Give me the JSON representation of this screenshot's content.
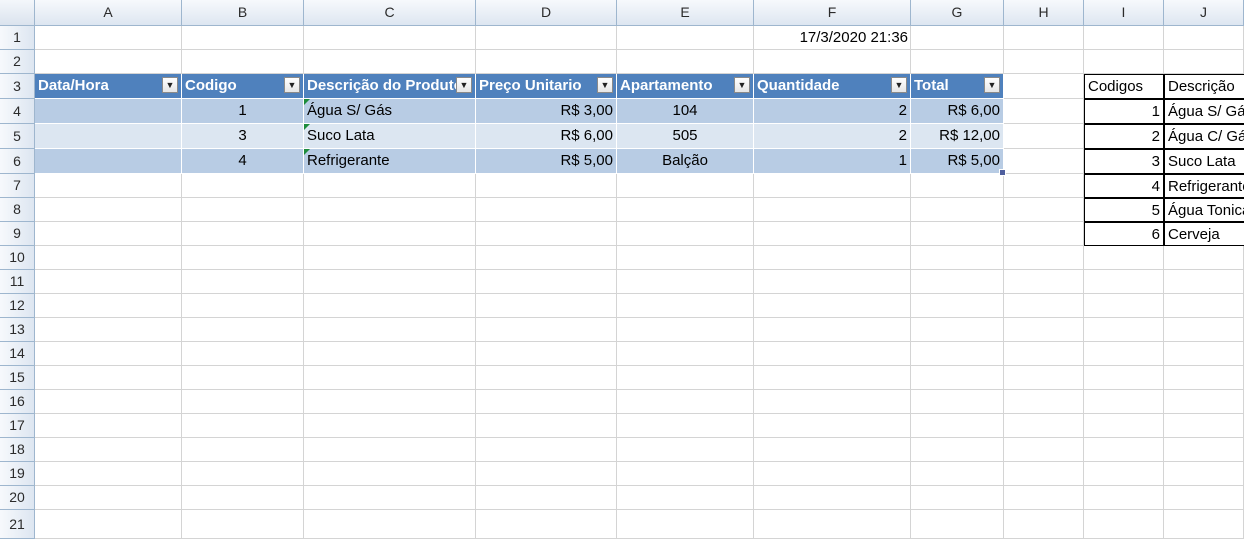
{
  "columns": [
    "A",
    "B",
    "C",
    "D",
    "E",
    "F",
    "G",
    "H",
    "I",
    "J"
  ],
  "rows": [
    "1",
    "2",
    "3",
    "4",
    "5",
    "6",
    "7",
    "8",
    "9",
    "10",
    "11",
    "12",
    "13",
    "14",
    "15",
    "16",
    "17",
    "18",
    "19",
    "20",
    "21"
  ],
  "timestamp": "17/3/2020 21:36",
  "table": {
    "headers": [
      "Data/Hora",
      "Codigo",
      "Descrição do Produto",
      "Preço Unitario",
      "Apartamento",
      "Quantidade",
      "Total"
    ],
    "filter_icon": "dropdown-arrow-icon",
    "rows": [
      {
        "data_hora": "",
        "codigo": "1",
        "descricao": "Água S/ Gás",
        "preco": "R$ 3,00",
        "apartamento": "104",
        "quantidade": "2",
        "total": "R$ 6,00"
      },
      {
        "data_hora": "",
        "codigo": "3",
        "descricao": "Suco Lata",
        "preco": "R$ 6,00",
        "apartamento": "505",
        "quantidade": "2",
        "total": "R$ 12,00"
      },
      {
        "data_hora": "",
        "codigo": "4",
        "descricao": "Refrigerante",
        "preco": "R$ 5,00",
        "apartamento": "Balção",
        "quantidade": "1",
        "total": "R$ 5,00"
      }
    ]
  },
  "lookup": {
    "headers": [
      "Codigos",
      "Descrição"
    ],
    "rows": [
      {
        "codigo": "1",
        "descricao": "Água S/ Gás"
      },
      {
        "codigo": "2",
        "descricao": "Água C/ Gás"
      },
      {
        "codigo": "3",
        "descricao": "Suco Lata"
      },
      {
        "codigo": "4",
        "descricao": "Refrigerante"
      },
      {
        "codigo": "5",
        "descricao": "Água Tonica"
      },
      {
        "codigo": "6",
        "descricao": "Cerveja"
      }
    ]
  },
  "colors": {
    "table_header": "#4f81bd",
    "band_dark": "#b8cce4",
    "band_light": "#dce6f1",
    "header_bg": "#dde6f1",
    "error_marker": "#1d8c3c"
  }
}
